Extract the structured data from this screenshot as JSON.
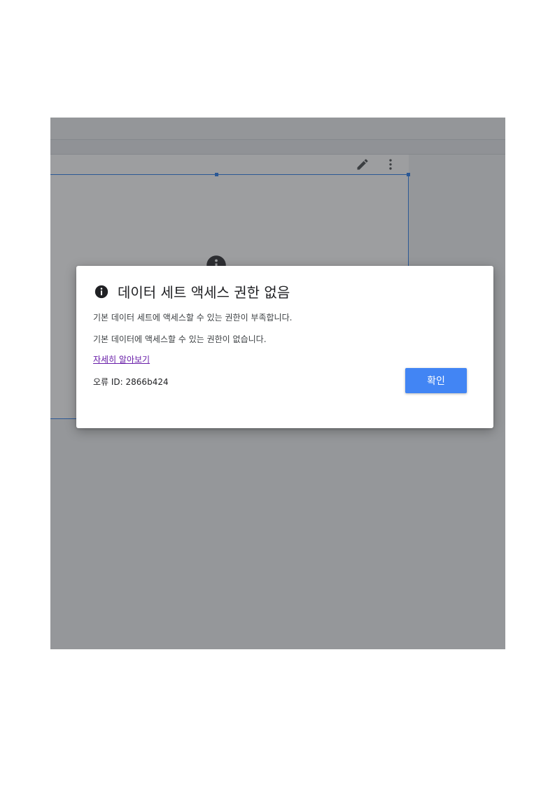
{
  "chart_toolbar": {
    "edit_icon": "pencil-icon",
    "more_icon": "more-vert-icon"
  },
  "dialog": {
    "icon": "info-icon",
    "title": "데이터 세트 액세스 권한 없음",
    "message_1": "기본 데이터 세트에 액세스할 수 있는 권한이 부족합니다.",
    "message_2": "기본 데이터에 액세스할 수 있는 권한이 없습니다.",
    "learn_more_link": "자세히 알아보기",
    "error_id": "오류 ID: 2866b424",
    "ok_button": "확인"
  },
  "colors": {
    "accent": "#4285f4",
    "selection": "#1a73e8",
    "link": "#681da8"
  }
}
